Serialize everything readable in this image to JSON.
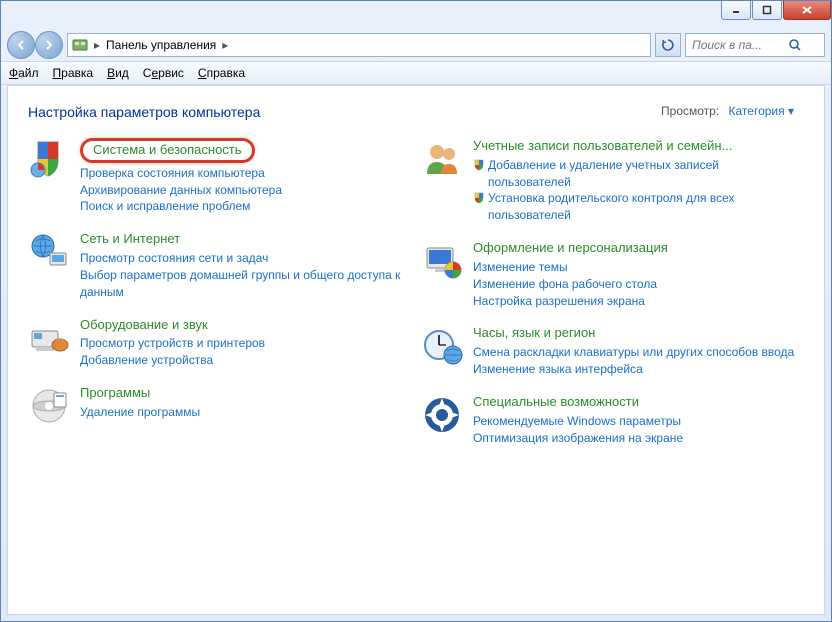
{
  "titlebar": {
    "min": "_",
    "max": "□",
    "close": "×"
  },
  "nav": {
    "address": "Панель управления",
    "searchPlaceholder": "Поиск в па..."
  },
  "menu": {
    "file": "Файл",
    "edit": "Правка",
    "view": "Вид",
    "tools": "Сервис",
    "help": "Справка"
  },
  "content": {
    "heading": "Настройка параметров компьютера",
    "viewLabel": "Просмотр:",
    "viewValue": "Категория"
  },
  "left": [
    {
      "title": "Система и безопасность",
      "highlight": true,
      "links": [
        {
          "t": "Проверка состояния компьютера"
        },
        {
          "t": "Архивирование данных компьютера"
        },
        {
          "t": "Поиск и исправление проблем"
        }
      ]
    },
    {
      "title": "Сеть и Интернет",
      "links": [
        {
          "t": "Просмотр состояния сети и задач"
        },
        {
          "t": "Выбор параметров домашней группы и общего доступа к данным"
        }
      ]
    },
    {
      "title": "Оборудование и звук",
      "links": [
        {
          "t": "Просмотр устройств и принтеров"
        },
        {
          "t": "Добавление устройства"
        }
      ]
    },
    {
      "title": "Программы",
      "links": [
        {
          "t": "Удаление программы"
        }
      ]
    }
  ],
  "right": [
    {
      "title": "Учетные записи пользователей и семейн...",
      "links": [
        {
          "t": "Добавление и удаление учетных записей пользователей",
          "shield": true
        },
        {
          "t": "Установка родительского контроля для всех пользователей",
          "shield": true
        }
      ]
    },
    {
      "title": "Оформление и персонализация",
      "links": [
        {
          "t": "Изменение темы"
        },
        {
          "t": "Изменение фона рабочего стола"
        },
        {
          "t": "Настройка разрешения экрана"
        }
      ]
    },
    {
      "title": "Часы, язык и регион",
      "links": [
        {
          "t": "Смена раскладки клавиатуры или других способов ввода"
        },
        {
          "t": "Изменение языка интерфейса"
        }
      ]
    },
    {
      "title": "Специальные возможности",
      "links": [
        {
          "t": "Рекомендуемые Windows параметры"
        },
        {
          "t": "Оптимизация изображения на экране"
        }
      ]
    }
  ]
}
